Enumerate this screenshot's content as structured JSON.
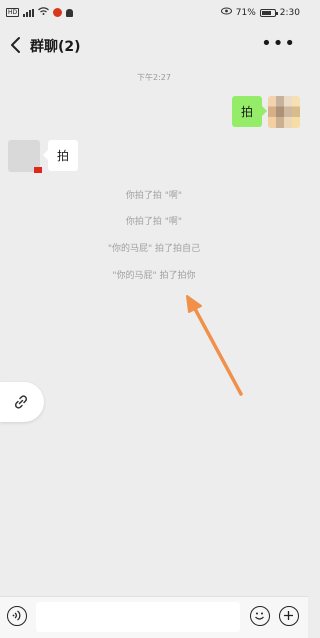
{
  "status_bar": {
    "battery": "71%",
    "time": "2:30"
  },
  "header": {
    "title": "群聊(2)",
    "more": "•••"
  },
  "chat": {
    "timestamp": "下午2:27",
    "outgoing_message": "拍",
    "incoming_message": "拍",
    "system_notices": [
      "你拍了拍 \"啊\"",
      "你拍了拍 \"啊\"",
      "\"你的马屁\" 拍了拍自己",
      "\"你的马屁\" 拍了拍你"
    ]
  },
  "icons": {
    "back": "chevron-left-icon",
    "more": "more-icon",
    "link": "link-icon",
    "voice": "voice-icon",
    "emoji": "emoji-icon",
    "plus": "plus-icon"
  },
  "colors": {
    "background": "#ededed",
    "outgoing_bubble": "#95ec69",
    "annotation_arrow": "#f0904a"
  }
}
